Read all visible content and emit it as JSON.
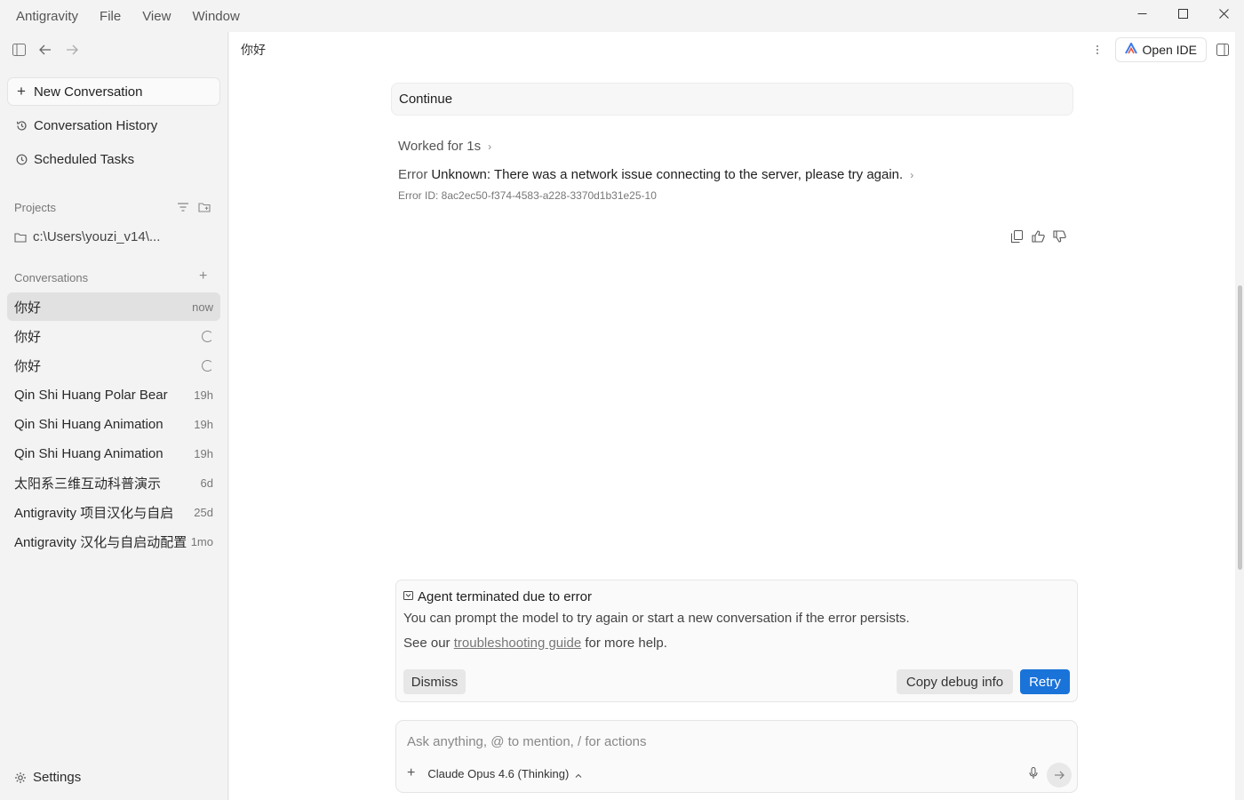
{
  "app": {
    "name": "Antigravity",
    "menu": [
      "File",
      "View",
      "Window"
    ]
  },
  "sidebar": {
    "new_conversation": "New Conversation",
    "conversation_history": "Conversation History",
    "scheduled_tasks": "Scheduled Tasks",
    "projects_label": "Projects",
    "project_path": "c:\\Users\\youzi_v14\\...",
    "conversations_label": "Conversations",
    "conversations": [
      {
        "title": "你好",
        "meta": "now",
        "state": "active"
      },
      {
        "title": "你好",
        "meta": "",
        "state": "loading"
      },
      {
        "title": "你好",
        "meta": "",
        "state": "loading"
      },
      {
        "title": "Qin Shi Huang Polar Bear",
        "meta": "19h",
        "state": ""
      },
      {
        "title": "Qin Shi Huang Animation",
        "meta": "19h",
        "state": ""
      },
      {
        "title": "Qin Shi Huang Animation",
        "meta": "19h",
        "state": ""
      },
      {
        "title": "太阳系三维互动科普演示",
        "meta": "6d",
        "state": ""
      },
      {
        "title": "Antigravity 项目汉化与自启",
        "meta": "25d",
        "state": ""
      },
      {
        "title": "Antigravity 汉化与自启动配置",
        "meta": "1mo",
        "state": ""
      }
    ],
    "settings": "Settings"
  },
  "main": {
    "conversation_title": "你好",
    "open_ide": "Open IDE",
    "user_message": "Continue",
    "worked_for": "Worked for 1s",
    "error_label": "Error",
    "error_message": "Unknown: There was a network issue connecting to the server, please try again.",
    "error_id": "Error ID: 8ac2ec50-f374-4583-a228-3370d1b31e25-10",
    "alert": {
      "title": "Agent terminated due to error",
      "text": "You can prompt the model to try again or start a new conversation if the error persists.",
      "help_prefix": "See our ",
      "help_link": "troubleshooting guide",
      "help_suffix": " for more help.",
      "dismiss": "Dismiss",
      "copy_debug": "Copy debug info",
      "retry": "Retry"
    },
    "composer": {
      "placeholder": "Ask anything, @ to mention, / for actions",
      "model": "Claude Opus 4.6 (Thinking)"
    }
  }
}
